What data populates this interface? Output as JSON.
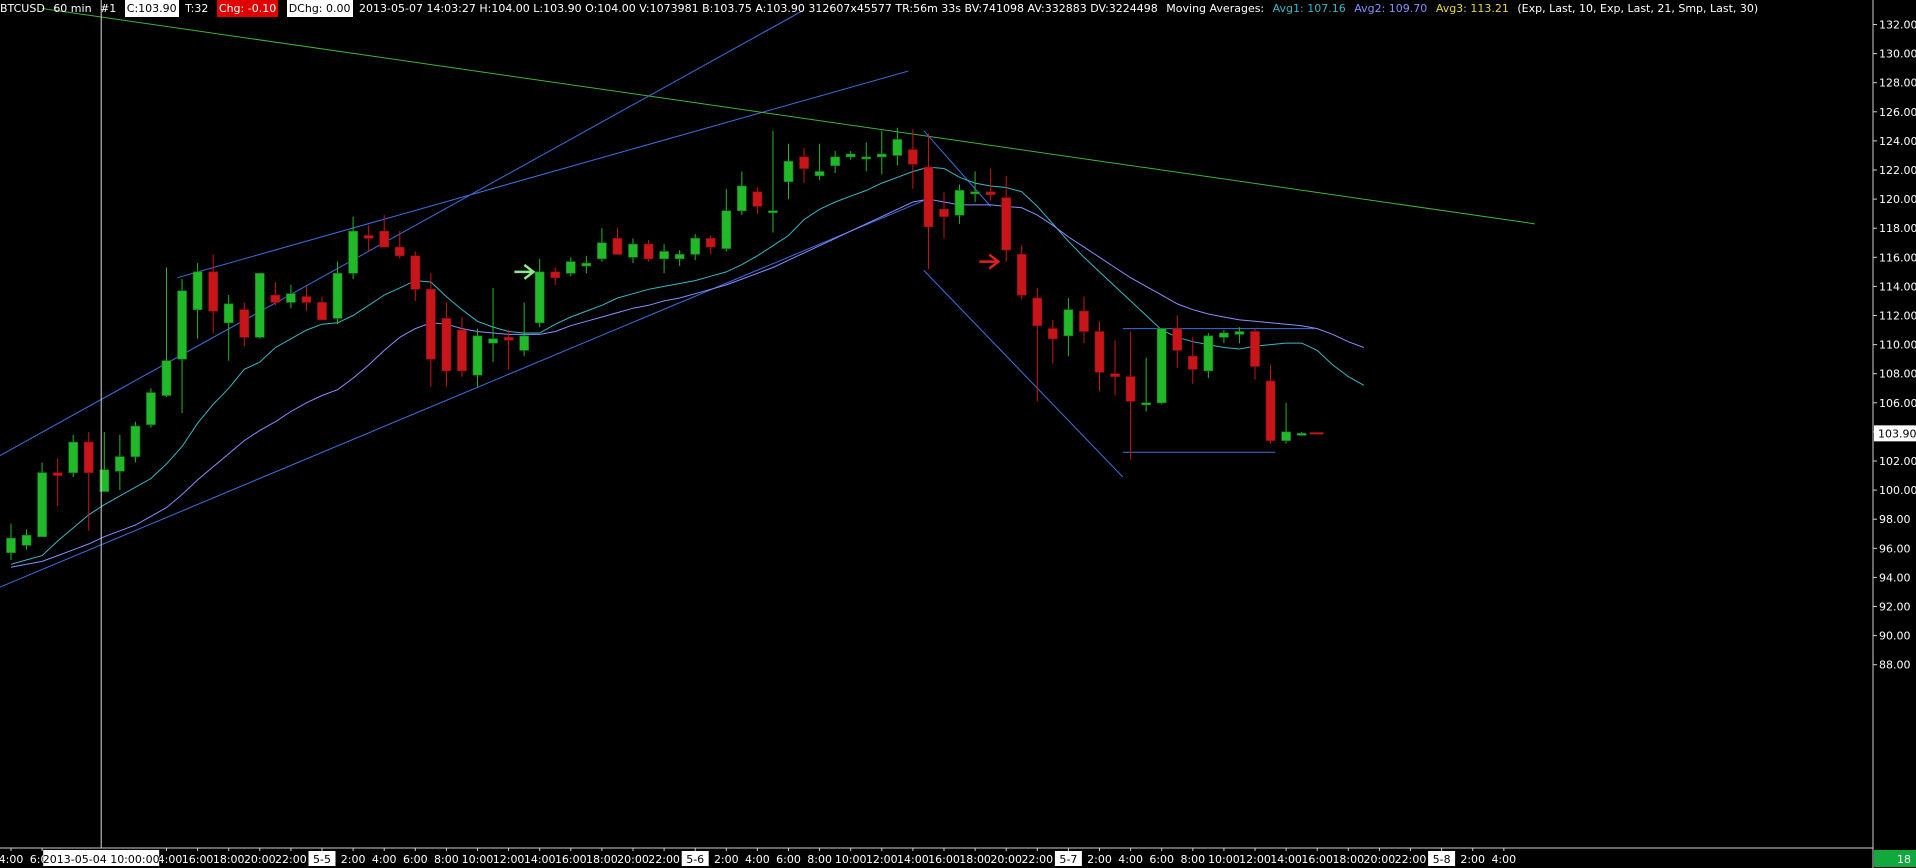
{
  "header": {
    "symbol": "BTCUSD",
    "interval": "60 min",
    "number": "#1",
    "close": "C:103.90",
    "trades": "T:32",
    "chg": "Chg: -0.10",
    "dchg": "DChg: 0.00",
    "stats": "2013-05-07 14:03:27 H:104.00 L:103.90 O:104.00 V:1073981 B:103.75 A:103.90 312607x45577 TR:56m 33s BV:741098 AV:332883 DV:3224498",
    "ma_label": "Moving Averages:",
    "avg1": "Avg1: 107.16",
    "avg2": "Avg2: 109.70",
    "avg3": "Avg3: 113.21",
    "params": "(Exp, Last, 10, Exp, Last, 21, Smp, Last, 30)"
  },
  "colors": {
    "bull": "#21b92a",
    "bear": "#c8151a",
    "avg1": "#39b7c6",
    "avg2": "#8b8dff",
    "channel": "#3d6fe0",
    "resistance": "#3fb33a",
    "axis_text": "#ffffff",
    "last_price_bg": "#ffffff",
    "bar_count_bg": "#11a83c"
  },
  "last_price": "103.90",
  "bar_count": "18",
  "crosshair_time": "2013-05-04 10:00:00",
  "chart_data": {
    "type": "candlestick",
    "ylim": [
      86,
      134
    ],
    "y_ticks": [
      "132.00",
      "130.00",
      "128.00",
      "126.00",
      "124.00",
      "122.00",
      "120.00",
      "118.00",
      "116.00",
      "114.00",
      "112.00",
      "110.00",
      "108.00",
      "106.00",
      "104.00",
      "102.00",
      "100.00",
      "98.00",
      "96.00",
      "94.00",
      "92.00",
      "90.00",
      "88.00"
    ],
    "x_ticks": [
      {
        "bar": 0,
        "label": "4:00"
      },
      {
        "bar": 2,
        "label": "6:00"
      },
      {
        "bar": 10,
        "label": "14:00"
      },
      {
        "bar": 12,
        "label": "16:00"
      },
      {
        "bar": 14,
        "label": "18:00"
      },
      {
        "bar": 16,
        "label": "20:00"
      },
      {
        "bar": 18,
        "label": "22:00"
      },
      {
        "bar": 20,
        "label": "5-5",
        "boxed": true
      },
      {
        "bar": 22,
        "label": "2:00"
      },
      {
        "bar": 24,
        "label": "4:00"
      },
      {
        "bar": 26,
        "label": "6:00"
      },
      {
        "bar": 28,
        "label": "8:00"
      },
      {
        "bar": 30,
        "label": "10:00"
      },
      {
        "bar": 32,
        "label": "12:00"
      },
      {
        "bar": 34,
        "label": "14:00"
      },
      {
        "bar": 36,
        "label": "16:00"
      },
      {
        "bar": 38,
        "label": "18:00"
      },
      {
        "bar": 40,
        "label": "20:00"
      },
      {
        "bar": 42,
        "label": "22:00"
      },
      {
        "bar": 44,
        "label": "5-6",
        "boxed": true
      },
      {
        "bar": 46,
        "label": "2:00"
      },
      {
        "bar": 48,
        "label": "4:00"
      },
      {
        "bar": 50,
        "label": "6:00"
      },
      {
        "bar": 52,
        "label": "8:00"
      },
      {
        "bar": 54,
        "label": "10:00"
      },
      {
        "bar": 56,
        "label": "12:00"
      },
      {
        "bar": 58,
        "label": "14:00"
      },
      {
        "bar": 60,
        "label": "16:00"
      },
      {
        "bar": 62,
        "label": "18:00"
      },
      {
        "bar": 64,
        "label": "20:00"
      },
      {
        "bar": 66,
        "label": "22:00"
      },
      {
        "bar": 68,
        "label": "5-7",
        "boxed": true
      },
      {
        "bar": 70,
        "label": "2:00"
      },
      {
        "bar": 72,
        "label": "4:00"
      },
      {
        "bar": 74,
        "label": "6:00"
      },
      {
        "bar": 76,
        "label": "8:00"
      },
      {
        "bar": 78,
        "label": "10:00"
      },
      {
        "bar": 80,
        "label": "12:00"
      },
      {
        "bar": 82,
        "label": "14:00"
      },
      {
        "bar": 84,
        "label": "16:00"
      },
      {
        "bar": 86,
        "label": "18:00"
      },
      {
        "bar": 88,
        "label": "20:00"
      },
      {
        "bar": 90,
        "label": "22:00"
      },
      {
        "bar": 92,
        "label": "5-8",
        "boxed": true
      },
      {
        "bar": 94,
        "label": "2:00"
      },
      {
        "bar": 96,
        "label": "4:00"
      }
    ],
    "candles": [
      {
        "o": 95.7,
        "h": 97.7,
        "l": 95.2,
        "c": 96.7
      },
      {
        "o": 96.2,
        "h": 97.3,
        "l": 95.9,
        "c": 96.9
      },
      {
        "o": 96.8,
        "h": 101.9,
        "l": 96.8,
        "c": 101.2
      },
      {
        "o": 101.2,
        "h": 102.2,
        "l": 98.9,
        "c": 101.0
      },
      {
        "o": 101.2,
        "h": 103.8,
        "l": 100.9,
        "c": 103.3
      },
      {
        "o": 103.3,
        "h": 104.0,
        "l": 97.2,
        "c": 101.2
      },
      {
        "o": 99.9,
        "h": 104.0,
        "l": 99.9,
        "c": 101.4
      },
      {
        "o": 101.3,
        "h": 103.8,
        "l": 100.0,
        "c": 102.3
      },
      {
        "o": 102.3,
        "h": 104.7,
        "l": 101.9,
        "c": 104.4
      },
      {
        "o": 104.5,
        "h": 107.0,
        "l": 104.3,
        "c": 106.7
      },
      {
        "o": 106.5,
        "h": 115.3,
        "l": 106.4,
        "c": 108.9
      },
      {
        "o": 109.0,
        "h": 114.5,
        "l": 105.3,
        "c": 113.7
      },
      {
        "o": 112.4,
        "h": 115.6,
        "l": 110.4,
        "c": 115.0
      },
      {
        "o": 115.0,
        "h": 116.2,
        "l": 110.8,
        "c": 112.3
      },
      {
        "o": 111.5,
        "h": 113.4,
        "l": 108.9,
        "c": 112.8
      },
      {
        "o": 112.4,
        "h": 112.9,
        "l": 109.9,
        "c": 110.5
      },
      {
        "o": 110.5,
        "h": 114.9,
        "l": 110.4,
        "c": 114.9
      },
      {
        "o": 113.4,
        "h": 114.3,
        "l": 112.7,
        "c": 112.9
      },
      {
        "o": 112.9,
        "h": 114.1,
        "l": 112.5,
        "c": 113.5
      },
      {
        "o": 113.3,
        "h": 114.0,
        "l": 112.3,
        "c": 112.9
      },
      {
        "o": 112.9,
        "h": 113.3,
        "l": 111.7,
        "c": 111.7
      },
      {
        "o": 111.8,
        "h": 115.7,
        "l": 111.4,
        "c": 114.9
      },
      {
        "o": 114.9,
        "h": 118.8,
        "l": 114.5,
        "c": 117.8
      },
      {
        "o": 117.5,
        "h": 118.2,
        "l": 116.4,
        "c": 117.3
      },
      {
        "o": 117.8,
        "h": 118.9,
        "l": 116.7,
        "c": 116.7
      },
      {
        "o": 116.7,
        "h": 117.8,
        "l": 115.9,
        "c": 116.1
      },
      {
        "o": 116.1,
        "h": 116.4,
        "l": 113.0,
        "c": 113.8
      },
      {
        "o": 113.8,
        "h": 114.9,
        "l": 107.1,
        "c": 109.0
      },
      {
        "o": 111.8,
        "h": 112.9,
        "l": 107.1,
        "c": 108.2
      },
      {
        "o": 111.0,
        "h": 111.9,
        "l": 107.8,
        "c": 108.2
      },
      {
        "o": 107.9,
        "h": 111.1,
        "l": 107.1,
        "c": 110.6
      },
      {
        "o": 110.1,
        "h": 113.9,
        "l": 108.8,
        "c": 110.4
      },
      {
        "o": 110.5,
        "h": 111.0,
        "l": 108.3,
        "c": 110.3
      },
      {
        "o": 109.6,
        "h": 112.9,
        "l": 109.2,
        "c": 110.6
      },
      {
        "o": 111.5,
        "h": 115.9,
        "l": 111.2,
        "c": 115.0
      },
      {
        "o": 115.0,
        "h": 115.3,
        "l": 114.1,
        "c": 114.6
      },
      {
        "o": 114.9,
        "h": 116.0,
        "l": 114.7,
        "c": 115.7
      },
      {
        "o": 115.4,
        "h": 116.1,
        "l": 114.9,
        "c": 115.6
      },
      {
        "o": 115.9,
        "h": 118.0,
        "l": 115.7,
        "c": 117.0
      },
      {
        "o": 117.3,
        "h": 118.0,
        "l": 116.2,
        "c": 116.2
      },
      {
        "o": 116.0,
        "h": 117.3,
        "l": 115.6,
        "c": 116.9
      },
      {
        "o": 116.9,
        "h": 117.2,
        "l": 115.7,
        "c": 115.9
      },
      {
        "o": 115.9,
        "h": 116.9,
        "l": 114.9,
        "c": 116.4
      },
      {
        "o": 115.9,
        "h": 116.5,
        "l": 115.4,
        "c": 116.2
      },
      {
        "o": 116.2,
        "h": 117.6,
        "l": 115.8,
        "c": 117.3
      },
      {
        "o": 117.3,
        "h": 117.5,
        "l": 116.2,
        "c": 116.7
      },
      {
        "o": 116.6,
        "h": 120.7,
        "l": 116.4,
        "c": 119.2
      },
      {
        "o": 119.2,
        "h": 121.9,
        "l": 118.9,
        "c": 120.9
      },
      {
        "o": 120.5,
        "h": 120.8,
        "l": 119.0,
        "c": 119.5
      },
      {
        "o": 119.1,
        "h": 124.7,
        "l": 117.7,
        "c": 119.2
      },
      {
        "o": 121.2,
        "h": 123.8,
        "l": 120.0,
        "c": 122.6
      },
      {
        "o": 122.9,
        "h": 123.5,
        "l": 121.1,
        "c": 122.1
      },
      {
        "o": 121.6,
        "h": 123.8,
        "l": 121.3,
        "c": 121.9
      },
      {
        "o": 122.3,
        "h": 123.3,
        "l": 121.8,
        "c": 122.9
      },
      {
        "o": 122.9,
        "h": 123.3,
        "l": 122.7,
        "c": 123.1
      },
      {
        "o": 122.9,
        "h": 123.9,
        "l": 121.9,
        "c": 122.9
      },
      {
        "o": 122.9,
        "h": 124.7,
        "l": 121.7,
        "c": 123.1
      },
      {
        "o": 123.0,
        "h": 124.9,
        "l": 122.3,
        "c": 124.1
      },
      {
        "o": 123.4,
        "h": 124.8,
        "l": 120.7,
        "c": 122.4
      },
      {
        "o": 122.2,
        "h": 124.5,
        "l": 115.2,
        "c": 118.1
      },
      {
        "o": 119.3,
        "h": 120.5,
        "l": 117.3,
        "c": 118.8
      },
      {
        "o": 118.9,
        "h": 121.0,
        "l": 118.3,
        "c": 120.6
      },
      {
        "o": 120.4,
        "h": 121.9,
        "l": 119.8,
        "c": 120.5
      },
      {
        "o": 120.5,
        "h": 122.1,
        "l": 119.9,
        "c": 120.3
      },
      {
        "o": 120.1,
        "h": 121.6,
        "l": 115.7,
        "c": 116.5
      },
      {
        "o": 116.2,
        "h": 116.8,
        "l": 113.1,
        "c": 113.4
      },
      {
        "o": 113.2,
        "h": 113.9,
        "l": 106.1,
        "c": 111.3
      },
      {
        "o": 111.1,
        "h": 111.7,
        "l": 108.7,
        "c": 110.4
      },
      {
        "o": 110.6,
        "h": 113.2,
        "l": 109.2,
        "c": 112.4
      },
      {
        "o": 112.3,
        "h": 113.3,
        "l": 110.1,
        "c": 110.9
      },
      {
        "o": 110.9,
        "h": 111.6,
        "l": 106.8,
        "c": 108.1
      },
      {
        "o": 108.0,
        "h": 110.3,
        "l": 106.5,
        "c": 107.8
      },
      {
        "o": 107.8,
        "h": 110.9,
        "l": 102.1,
        "c": 106.1
      },
      {
        "o": 106.0,
        "h": 109.1,
        "l": 105.4,
        "c": 106.0
      },
      {
        "o": 106.0,
        "h": 111.1,
        "l": 105.9,
        "c": 111.1
      },
      {
        "o": 111.1,
        "h": 112.0,
        "l": 108.4,
        "c": 109.6
      },
      {
        "o": 109.2,
        "h": 110.5,
        "l": 107.3,
        "c": 108.3
      },
      {
        "o": 108.2,
        "h": 110.8,
        "l": 107.7,
        "c": 110.6
      },
      {
        "o": 110.5,
        "h": 111.0,
        "l": 110.1,
        "c": 110.8
      },
      {
        "o": 110.7,
        "h": 111.2,
        "l": 110.1,
        "c": 110.9
      },
      {
        "o": 110.9,
        "h": 111.1,
        "l": 107.6,
        "c": 108.5
      },
      {
        "o": 107.5,
        "h": 108.6,
        "l": 103.2,
        "c": 103.4
      },
      {
        "o": 103.4,
        "h": 106.0,
        "l": 103.2,
        "c": 104.0
      },
      {
        "o": 103.9,
        "h": 104.0,
        "l": 103.9,
        "c": 103.9
      }
    ],
    "series": [
      {
        "name": "Avg1",
        "values": [
          94.9,
          95.2,
          95.5,
          96.5,
          97.4,
          98.3,
          99.0,
          99.6,
          100.2,
          100.8,
          101.8,
          103.0,
          104.6,
          105.9,
          107.0,
          108.3,
          108.8,
          109.8,
          110.4,
          111.0,
          111.4,
          111.5,
          112.0,
          112.7,
          113.4,
          113.9,
          114.4,
          114.3,
          113.3,
          112.4,
          111.6,
          111.2,
          110.9,
          110.8,
          110.8,
          111.4,
          111.9,
          112.3,
          112.7,
          113.2,
          113.5,
          113.8,
          114.0,
          114.2,
          114.4,
          114.7,
          115.0,
          115.5,
          116.1,
          116.8,
          117.5,
          118.6,
          119.3,
          119.8,
          120.2,
          120.6,
          121.1,
          121.5,
          121.9,
          122.2,
          122.1,
          121.5,
          121.1,
          120.9,
          120.8,
          120.5,
          119.5,
          118.3,
          117.1,
          116.0,
          115.0,
          114.0,
          113.0,
          112.0,
          111.0,
          110.5,
          110.2,
          110.0,
          109.8,
          109.7,
          109.9,
          110.0,
          110.1,
          110.1,
          109.6,
          108.6,
          107.8,
          107.2
        ]
      },
      {
        "name": "Avg2",
        "values": [
          94.7,
          94.9,
          95.1,
          95.5,
          95.9,
          96.3,
          96.8,
          97.2,
          97.6,
          98.2,
          98.8,
          99.7,
          100.7,
          101.6,
          102.5,
          103.4,
          104.1,
          104.7,
          105.4,
          106.0,
          106.5,
          106.9,
          107.7,
          108.6,
          109.6,
          110.5,
          111.1,
          111.5,
          111.4,
          111.1,
          110.9,
          110.8,
          110.7,
          110.7,
          110.7,
          110.9,
          111.3,
          111.6,
          111.9,
          112.2,
          112.5,
          112.7,
          113.0,
          113.2,
          113.5,
          113.8,
          114.1,
          114.5,
          114.9,
          115.3,
          115.8,
          116.3,
          116.8,
          117.3,
          117.8,
          118.3,
          118.8,
          119.3,
          119.8,
          120.0,
          119.8,
          119.6,
          119.6,
          119.6,
          119.5,
          119.4,
          118.9,
          118.2,
          117.4,
          116.7,
          116.0,
          115.3,
          114.6,
          114.0,
          113.4,
          112.8,
          112.4,
          112.1,
          111.9,
          111.7,
          111.6,
          111.5,
          111.4,
          111.3,
          111.1,
          110.7,
          110.2,
          109.8
        ]
      }
    ],
    "annotations": [
      {
        "type": "line",
        "name": "channel-upper",
        "x1": -1,
        "y1": 102.2,
        "x2": 51,
        "y2": 133.0
      },
      {
        "type": "line",
        "name": "channel-mid",
        "x1": 10.7,
        "y1": 114.6,
        "x2": 57.7,
        "y2": 128.8
      },
      {
        "type": "line",
        "name": "channel-lower",
        "x1": -1,
        "y1": 93.2,
        "x2": 58.7,
        "y2": 119.9
      },
      {
        "type": "line",
        "name": "resistance",
        "x1": 2,
        "y1": 133.1,
        "x2": 98,
        "y2": 118.3
      },
      {
        "type": "line",
        "name": "down-channel-outer",
        "x1": 58.7,
        "y1": 124.7,
        "x2": 63,
        "y2": 119.5
      },
      {
        "type": "line",
        "name": "down-channel-lower",
        "x1": 58.7,
        "y1": 115.1,
        "x2": 71.5,
        "y2": 100.9
      },
      {
        "type": "line",
        "name": "range-top",
        "x1": 71.5,
        "y1": 111.1,
        "x2": 83.8,
        "y2": 111.1
      },
      {
        "type": "line",
        "name": "range-bottom",
        "x1": 71.5,
        "y1": 102.6,
        "x2": 81.3,
        "y2": 102.6
      },
      {
        "type": "arrow",
        "name": "buy-arrow",
        "bar": 33.4,
        "y": 115.0,
        "color": "#8be88b"
      },
      {
        "type": "arrow",
        "name": "sell-arrow",
        "bar": 63.3,
        "y": 115.7,
        "color": "#e02020"
      }
    ],
    "crosshair_bar": 5.8
  }
}
